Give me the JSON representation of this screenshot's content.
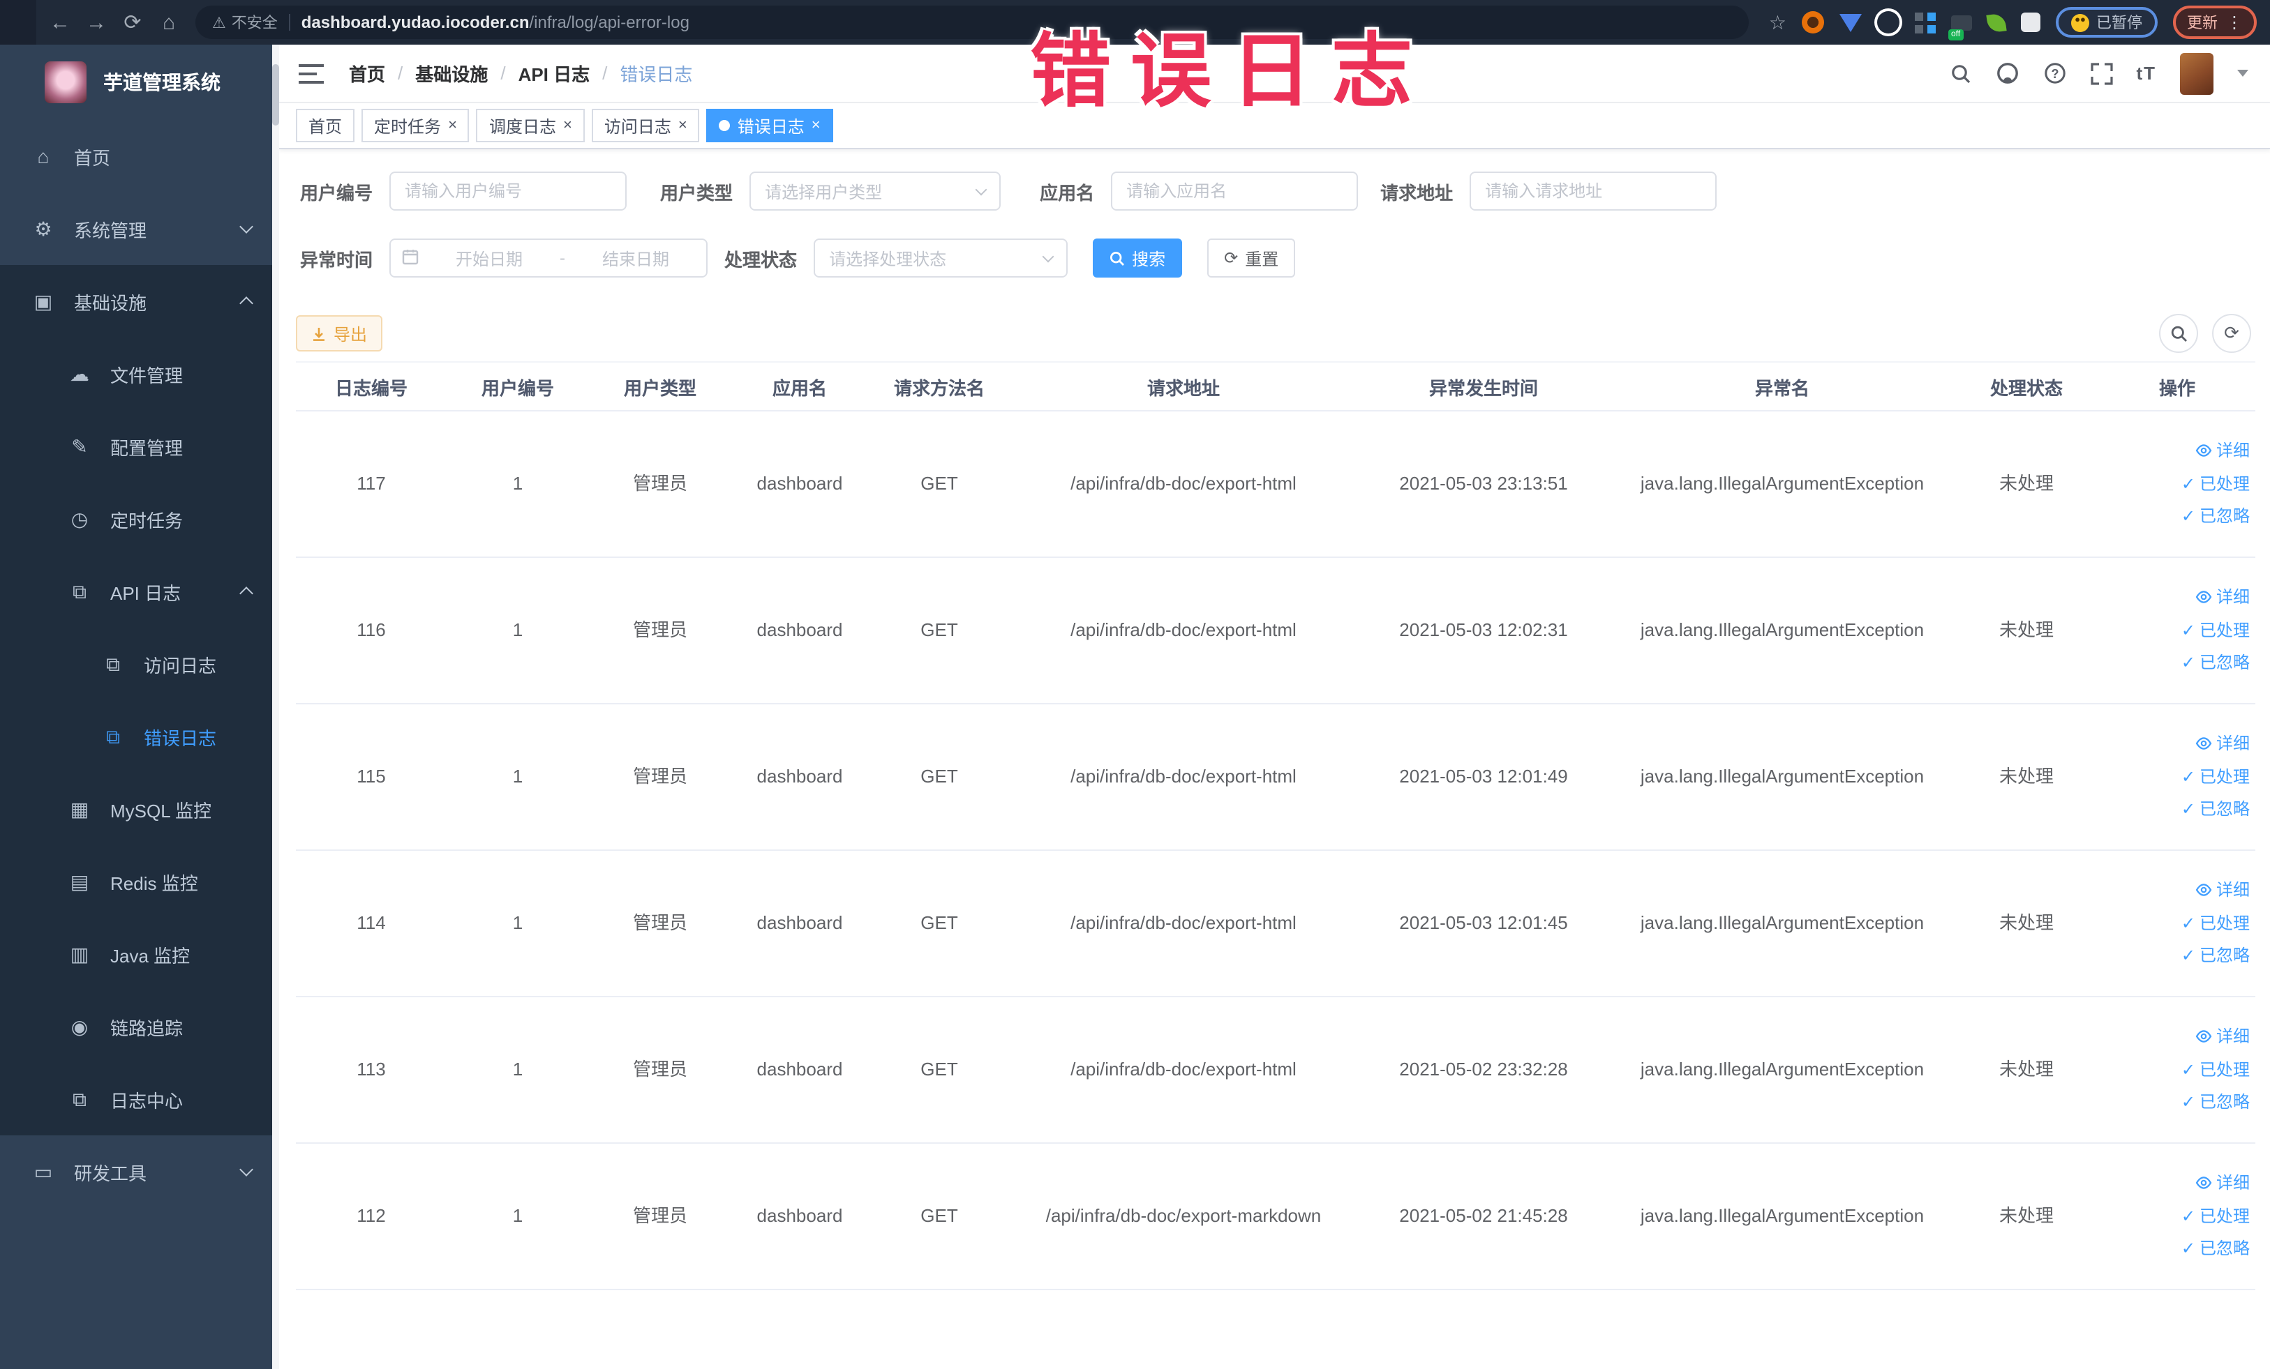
{
  "colors": {
    "accent": "#409eff",
    "overlay_red": "#ec3157",
    "export_warning": "#e6a23c",
    "sidebar_bg": "#304156",
    "submenu_bg": "#1f2d3d",
    "active_tab_bg": "#409eff"
  },
  "overlay": {
    "text": "错误日志",
    "color": "#ec3157"
  },
  "browser": {
    "security_label": "不安全",
    "url_domain": "dashboard.yudao.iocoder.cn",
    "url_path": "/infra/log/api-error-log",
    "paused_label": "已暂停",
    "update_label": "更新"
  },
  "sidebar": {
    "app_title": "芋道管理系统",
    "items": [
      {
        "key": "home",
        "label": "首页",
        "icon": "home",
        "level": 1
      },
      {
        "key": "system-management",
        "label": "系统管理",
        "icon": "gear",
        "level": 1,
        "arrow": "down"
      },
      {
        "key": "infrastructure",
        "label": "基础设施",
        "icon": "monitor",
        "level": 1,
        "arrow": "up",
        "dark": true
      },
      {
        "key": "file-management",
        "label": "文件管理",
        "icon": "cloud",
        "level": 2,
        "dark": true
      },
      {
        "key": "config-management",
        "label": "配置管理",
        "icon": "edit",
        "level": 2,
        "dark": true
      },
      {
        "key": "scheduled-tasks",
        "label": "定时任务",
        "icon": "clock",
        "level": 2,
        "dark": true
      },
      {
        "key": "api-log",
        "label": "API 日志",
        "icon": "log",
        "level": 2,
        "arrow": "up",
        "dark": true
      },
      {
        "key": "access-log",
        "label": "访问日志",
        "icon": "log",
        "level": 3,
        "dark": true
      },
      {
        "key": "error-log",
        "label": "错误日志",
        "icon": "log",
        "level": 3,
        "dark": true,
        "active": true
      },
      {
        "key": "mysql-monitor",
        "label": "MySQL 监控",
        "icon": "chart",
        "level": 2,
        "dark": true
      },
      {
        "key": "redis-monitor",
        "label": "Redis 监控",
        "icon": "db",
        "level": 2,
        "dark": true
      },
      {
        "key": "java-monitor",
        "label": "Java 监控",
        "icon": "java",
        "level": 2,
        "dark": true
      },
      {
        "key": "trace",
        "label": "链路追踪",
        "icon": "eye",
        "level": 2,
        "dark": true
      },
      {
        "key": "log-center",
        "label": "日志中心",
        "icon": "log",
        "level": 2,
        "dark": true
      },
      {
        "key": "dev-tools",
        "label": "研发工具",
        "icon": "tools",
        "level": 1,
        "arrow": "down"
      }
    ]
  },
  "header": {
    "breadcrumb": [
      "首页",
      "基础设施",
      "API 日志",
      "错误日志"
    ]
  },
  "tags": [
    {
      "key": "home",
      "label": "首页",
      "closable": false,
      "active": false
    },
    {
      "key": "scheduled-tasks",
      "label": "定时任务",
      "closable": true,
      "active": false
    },
    {
      "key": "schedule-log",
      "label": "调度日志",
      "closable": true,
      "active": false
    },
    {
      "key": "access-log",
      "label": "访问日志",
      "closable": true,
      "active": false
    },
    {
      "key": "error-log",
      "label": "错误日志",
      "closable": true,
      "active": true
    }
  ],
  "filters": {
    "user_id": {
      "label": "用户编号",
      "placeholder": "请输入用户编号"
    },
    "user_type": {
      "label": "用户类型",
      "placeholder": "请选择用户类型"
    },
    "app_name": {
      "label": "应用名",
      "placeholder": "请输入应用名"
    },
    "request_url": {
      "label": "请求地址",
      "placeholder": "请输入请求地址"
    },
    "exception_time": {
      "label": "异常时间",
      "start_placeholder": "开始日期",
      "range_separator": "-",
      "end_placeholder": "结束日期"
    },
    "process_status": {
      "label": "处理状态",
      "placeholder": "请选择处理状态"
    },
    "search_label": "搜索",
    "reset_label": "重置"
  },
  "toolbar": {
    "export_label": "导出"
  },
  "table": {
    "columns": [
      "日志编号",
      "用户编号",
      "用户类型",
      "应用名",
      "请求方法名",
      "请求地址",
      "异常发生时间",
      "异常名",
      "处理状态",
      "操作"
    ],
    "row_keys": [
      "id",
      "user_id",
      "user_type",
      "app",
      "method",
      "url",
      "time",
      "exception",
      "status"
    ],
    "actions": [
      "详细",
      "已处理",
      "已忽略"
    ],
    "rows": [
      {
        "id": "117",
        "user_id": "1",
        "user_type": "管理员",
        "app": "dashboard",
        "method": "GET",
        "url": "/api/infra/db-doc/export-html",
        "time": "2021-05-03 23:13:51",
        "exception": "java.lang.IllegalArgumentException",
        "status": "未处理"
      },
      {
        "id": "116",
        "user_id": "1",
        "user_type": "管理员",
        "app": "dashboard",
        "method": "GET",
        "url": "/api/infra/db-doc/export-html",
        "time": "2021-05-03 12:02:31",
        "exception": "java.lang.IllegalArgumentException",
        "status": "未处理"
      },
      {
        "id": "115",
        "user_id": "1",
        "user_type": "管理员",
        "app": "dashboard",
        "method": "GET",
        "url": "/api/infra/db-doc/export-html",
        "time": "2021-05-03 12:01:49",
        "exception": "java.lang.IllegalArgumentException",
        "status": "未处理"
      },
      {
        "id": "114",
        "user_id": "1",
        "user_type": "管理员",
        "app": "dashboard",
        "method": "GET",
        "url": "/api/infra/db-doc/export-html",
        "time": "2021-05-03 12:01:45",
        "exception": "java.lang.IllegalArgumentException",
        "status": "未处理"
      },
      {
        "id": "113",
        "user_id": "1",
        "user_type": "管理员",
        "app": "dashboard",
        "method": "GET",
        "url": "/api/infra/db-doc/export-html",
        "time": "2021-05-02 23:32:28",
        "exception": "java.lang.IllegalArgumentException",
        "status": "未处理"
      },
      {
        "id": "112",
        "user_id": "1",
        "user_type": "管理员",
        "app": "dashboard",
        "method": "GET",
        "url": "/api/infra/db-doc/export-markdown",
        "time": "2021-05-02 21:45:28",
        "exception": "java.lang.IllegalArgumentException",
        "status": "未处理"
      }
    ]
  }
}
